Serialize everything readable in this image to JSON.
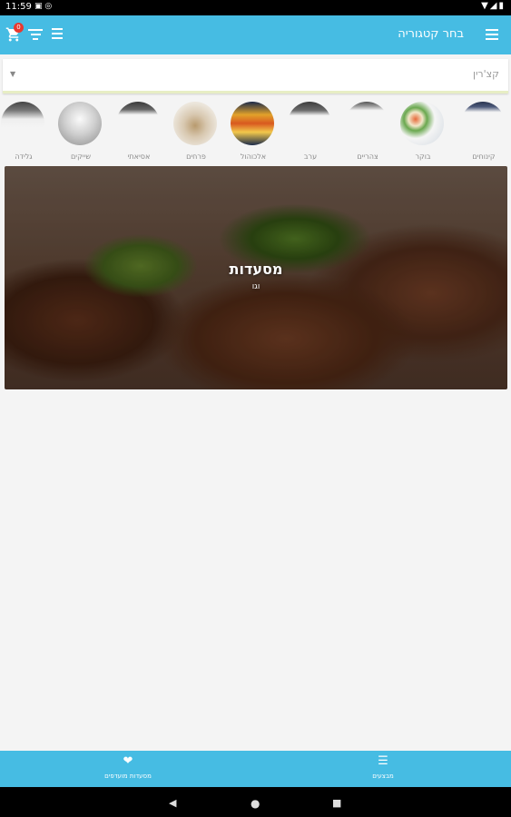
{
  "status_bar": {
    "time": "11:59"
  },
  "header": {
    "title": "בחר קטגוריה",
    "cart_badge": "0"
  },
  "search": {
    "value": "קצ'רין"
  },
  "categories": [
    {
      "label": "גלידה"
    },
    {
      "label": "שייקים"
    },
    {
      "label": "אסיאתי"
    },
    {
      "label": "פרחים"
    },
    {
      "label": "אלכוהול"
    },
    {
      "label": "ערב"
    },
    {
      "label": "צהריים"
    },
    {
      "label": "בוקר"
    },
    {
      "label": "קינוחים"
    }
  ],
  "banner": {
    "title": "מסעדות",
    "subtitle": "וגו"
  },
  "bottom_nav": {
    "tabs": [
      {
        "label": "מסעדות מועדפים"
      },
      {
        "label": "מבצעים"
      }
    ]
  },
  "colors": {
    "primary": "#46bce3",
    "badge": "#e8382f",
    "background": "#f4f4f4"
  },
  "icons": {
    "status": [
      "whatsapp-icon",
      "notification-icon",
      "wifi-icon",
      "battery-icon"
    ],
    "header": [
      "cart-icon",
      "filter-icon",
      "list-icon",
      "menu-icon"
    ],
    "bottom": [
      "heart-icon",
      "list-icon"
    ],
    "nav": [
      "back-icon",
      "home-icon",
      "recents-icon"
    ]
  }
}
